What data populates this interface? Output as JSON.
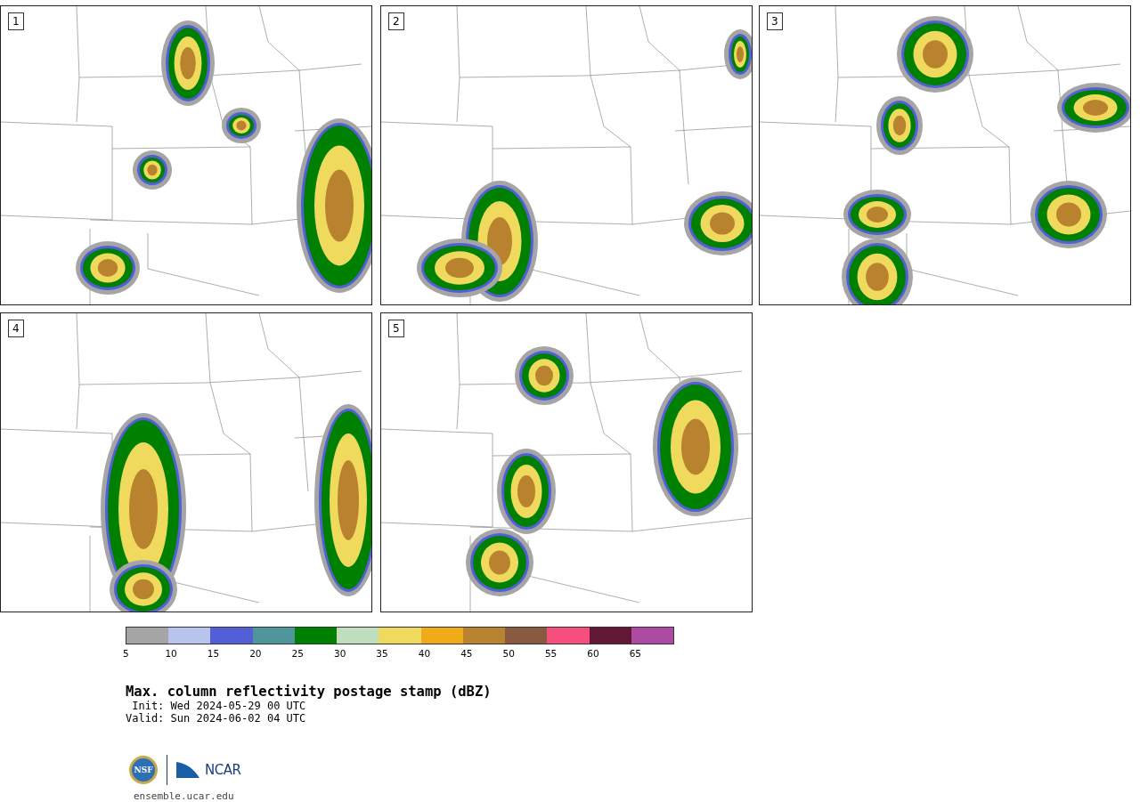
{
  "panels": [
    {
      "number": "1"
    },
    {
      "number": "2"
    },
    {
      "number": "3"
    },
    {
      "number": "4"
    },
    {
      "number": "5"
    }
  ],
  "colorbar": [
    {
      "color": "#a5a5a5",
      "tick": "5"
    },
    {
      "color": "#b8c3ee",
      "tick": "10"
    },
    {
      "color": "#525fd6",
      "tick": "15"
    },
    {
      "color": "#4f969c",
      "tick": "20"
    },
    {
      "color": "#008000",
      "tick": "25"
    },
    {
      "color": "#bfdebe",
      "tick": "30"
    },
    {
      "color": "#f0da5d",
      "tick": "35"
    },
    {
      "color": "#f0ac18",
      "tick": "40"
    },
    {
      "color": "#b9822f",
      "tick": "45"
    },
    {
      "color": "#8a5a40",
      "tick": "50"
    },
    {
      "color": "#f64e7d",
      "tick": "55"
    },
    {
      "color": "#621735",
      "tick": "60"
    },
    {
      "color": "#ac4aa4",
      "tick": "65"
    }
  ],
  "title": "Max. column reflectivity postage stamp (dBZ)",
  "init": " Init: Wed 2024-05-29 00 UTC",
  "valid": "Valid: Sun 2024-06-02 04 UTC",
  "logos": {
    "nsf": "NSF",
    "ncar": "NCAR"
  },
  "url": "ensemble.ucar.edu"
}
